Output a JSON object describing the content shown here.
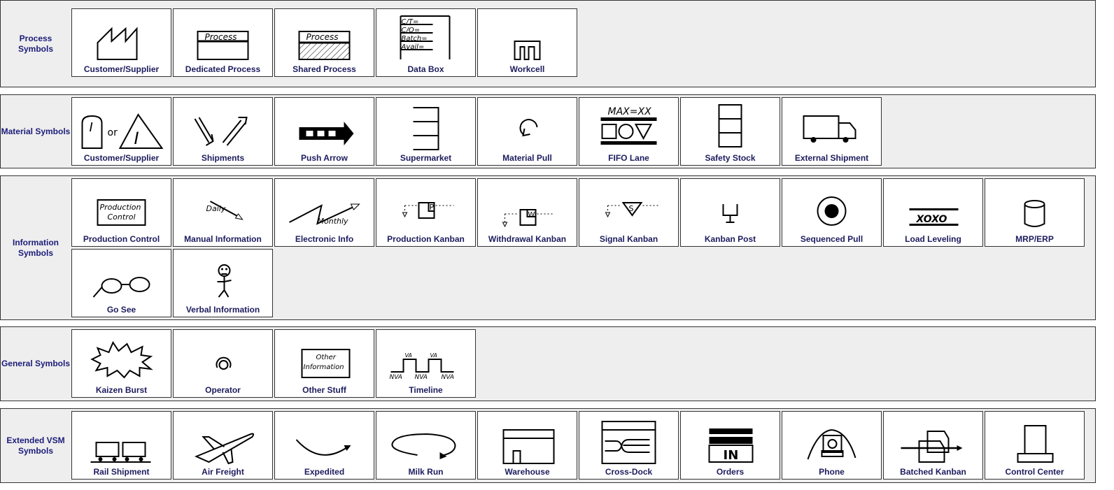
{
  "sections": [
    {
      "id": "process",
      "label": "Process Symbols",
      "items": [
        {
          "label": "Customer/Supplier",
          "icon": "factory-icon"
        },
        {
          "label": "Dedicated Process",
          "icon": "dedicated-process-icon",
          "text": [
            "Process"
          ]
        },
        {
          "label": "Shared Process",
          "icon": "shared-process-icon",
          "text": [
            "Process"
          ]
        },
        {
          "label": "Data Box",
          "icon": "data-box-icon",
          "text": [
            "C/T=",
            "C/O=",
            "Batch=",
            "Avail="
          ]
        },
        {
          "label": "Workcell",
          "icon": "workcell-icon"
        }
      ]
    },
    {
      "id": "material",
      "label": "Material Symbols",
      "items": [
        {
          "label": "Customer/Supplier",
          "icon": "inventory-icon",
          "text": [
            "I",
            "or",
            "I"
          ]
        },
        {
          "label": "Shipments",
          "icon": "shipments-icon"
        },
        {
          "label": "Push Arrow",
          "icon": "push-arrow-icon"
        },
        {
          "label": "Supermarket",
          "icon": "supermarket-icon"
        },
        {
          "label": "Material Pull",
          "icon": "material-pull-icon"
        },
        {
          "label": "FIFO Lane",
          "icon": "fifo-lane-icon",
          "text": [
            "MAX=XX"
          ]
        },
        {
          "label": "Safety Stock",
          "icon": "safety-stock-icon"
        },
        {
          "label": "External Shipment",
          "icon": "truck-icon"
        }
      ]
    },
    {
      "id": "information",
      "label": "Information Symbols",
      "items": [
        {
          "label": "Production Control",
          "icon": "production-control-icon",
          "text": [
            "Production",
            "Control"
          ]
        },
        {
          "label": "Manual Information",
          "icon": "manual-info-icon",
          "text": [
            "Daily"
          ]
        },
        {
          "label": "Electronic Info",
          "icon": "electronic-info-icon",
          "text": [
            "Monthly"
          ]
        },
        {
          "label": "Production Kanban",
          "icon": "production-kanban-icon",
          "text": [
            "P"
          ]
        },
        {
          "label": "Withdrawal Kanban",
          "icon": "withdrawal-kanban-icon",
          "text": [
            "W"
          ]
        },
        {
          "label": "Signal Kanban",
          "icon": "signal-kanban-icon",
          "text": [
            "S"
          ]
        },
        {
          "label": "Kanban Post",
          "icon": "kanban-post-icon"
        },
        {
          "label": "Sequenced Pull",
          "icon": "sequenced-pull-icon"
        },
        {
          "label": "Load Leveling",
          "icon": "load-leveling-icon",
          "text": [
            "XOXO"
          ]
        },
        {
          "label": "MRP/ERP",
          "icon": "database-icon"
        },
        {
          "label": "Go See",
          "icon": "glasses-icon"
        },
        {
          "label": "Verbal Information",
          "icon": "stick-figure-icon"
        }
      ]
    },
    {
      "id": "general",
      "label": "General Symbols",
      "items": [
        {
          "label": "Kaizen Burst",
          "icon": "kaizen-burst-icon"
        },
        {
          "label": "Operator",
          "icon": "operator-icon"
        },
        {
          "label": "Other Stuff",
          "icon": "other-info-icon",
          "text": [
            "Other",
            "Information"
          ]
        },
        {
          "label": "Timeline",
          "icon": "timeline-icon",
          "text": [
            "VA",
            "VA",
            "NVA",
            "NVA",
            "NVA"
          ]
        }
      ]
    },
    {
      "id": "extended",
      "label": "Extended VSM Symbols",
      "items": [
        {
          "label": "Rail Shipment",
          "icon": "rail-icon"
        },
        {
          "label": "Air Freight",
          "icon": "airplane-icon"
        },
        {
          "label": "Expedited",
          "icon": "expedited-icon"
        },
        {
          "label": "Milk Run",
          "icon": "milk-run-icon"
        },
        {
          "label": "Warehouse",
          "icon": "warehouse-icon"
        },
        {
          "label": "Cross-Dock",
          "icon": "cross-dock-icon"
        },
        {
          "label": "Orders",
          "icon": "orders-icon",
          "text": [
            "IN"
          ]
        },
        {
          "label": "Phone",
          "icon": "phone-icon"
        },
        {
          "label": "Batched Kanban",
          "icon": "batched-kanban-icon"
        },
        {
          "label": "Control Center",
          "icon": "control-center-icon"
        }
      ]
    }
  ],
  "colors": {
    "section_bg": "#eeeeee",
    "label_text": "#1c1c7a",
    "tile_label": "#1c1c5e"
  }
}
